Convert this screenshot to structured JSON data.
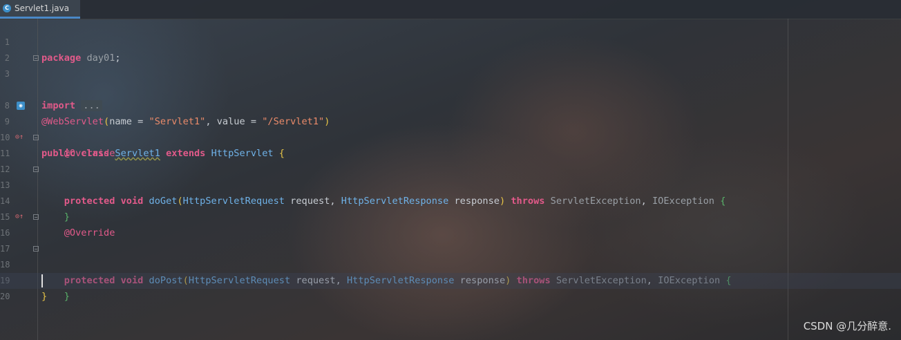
{
  "tab": {
    "title": "Servlet1.java",
    "icon": "java-class-icon"
  },
  "lines": [
    {
      "n": "1",
      "text": "package day01;"
    },
    {
      "n": "2",
      "text": ""
    },
    {
      "n": "3",
      "text": "import ..."
    },
    {
      "n": "8",
      "text": "@WebServlet(name = \"Servlet1\", value = \"/Servlet1\")"
    },
    {
      "n": "9",
      "text": "public class Servlet1 extends HttpServlet {"
    },
    {
      "n": "10",
      "text": "    @Override"
    },
    {
      "n": "11",
      "text": "    protected void doGet(HttpServletRequest request, HttpServletResponse response) throws ServletException, IOException {"
    },
    {
      "n": "12",
      "text": ""
    },
    {
      "n": "13",
      "text": "    }"
    },
    {
      "n": "14",
      "text": ""
    },
    {
      "n": "15",
      "text": "    @Override"
    },
    {
      "n": "16",
      "text": "    protected void doPost(HttpServletRequest request, HttpServletResponse response) throws ServletException, IOException {"
    },
    {
      "n": "17",
      "text": ""
    },
    {
      "n": "18",
      "text": "    }"
    },
    {
      "n": "19",
      "text": "}"
    },
    {
      "n": "20",
      "text": ""
    }
  ],
  "watermark": "CSDN @几分醉意."
}
